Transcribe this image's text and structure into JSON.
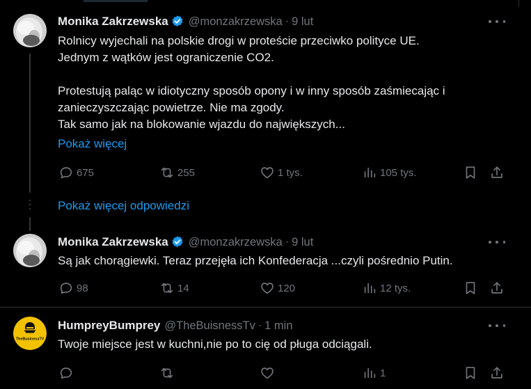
{
  "tweets": [
    {
      "name": "Monika Zakrzewska",
      "handle": "@monzakrzewska",
      "sep": "·",
      "time": "9 lut",
      "lines": [
        "Rolnicy wyjechali na polskie drogi w proteście przeciwko polityce UE.",
        "Jednym z wątków jest ograniczenie CO2.",
        "",
        "Protestują paląc w idiotyczny sposób opony i w inny sposób zaśmiecając i",
        "zanieczyszczając powietrze. Nie ma zgody.",
        "Tak samo jak na blokowanie wjazdu do największych..."
      ],
      "show_more": "Pokaż więcej",
      "replies": "675",
      "retweets": "255",
      "likes": "1 tys.",
      "views": "105 tys."
    },
    {
      "name": "Monika Zakrzewska",
      "handle": "@monzakrzewska",
      "sep": "·",
      "time": "9 lut",
      "lines": [
        "Są jak chorągiewki. Teraz przejęła ich Konfederacja ...czyli pośrednio Putin."
      ],
      "replies": "98",
      "retweets": "14",
      "likes": "120",
      "views": "12 tys."
    },
    {
      "name": "HumpreyBumprey",
      "handle": "@TheBuisnessTv",
      "sep": "·",
      "time": "1 min",
      "avatar_text": "TheBusinessTV",
      "lines": [
        "Twoje miejsce jest w kuchni,nie po to cię od pługa odciągali."
      ],
      "replies": "",
      "retweets": "",
      "likes": "",
      "views": "1"
    }
  ],
  "show_more_replies": "Pokaż więcej odpowiedzi",
  "colors": {
    "accent": "#1d9bf0",
    "muted": "#71767b",
    "text": "#e7e9ea",
    "background": "#000000"
  }
}
